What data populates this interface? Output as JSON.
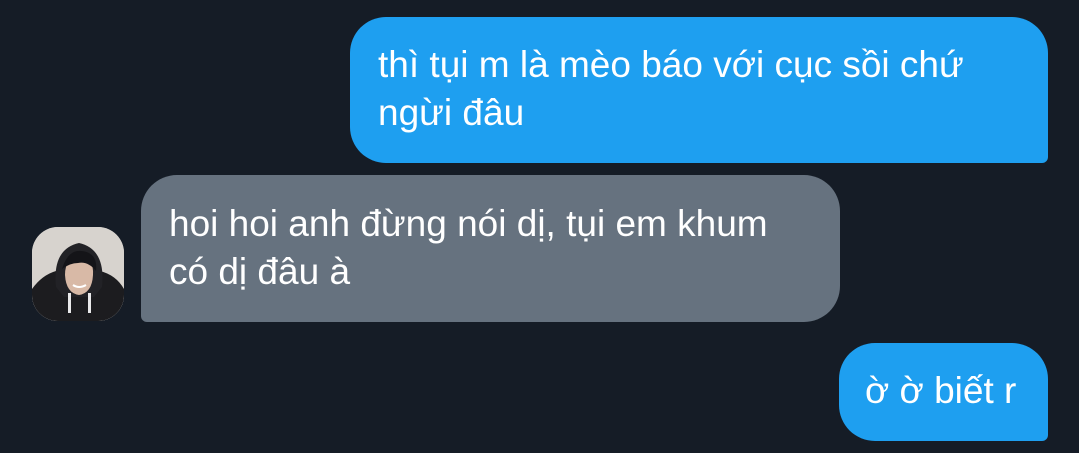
{
  "conversation": {
    "messages": [
      {
        "direction": "sent",
        "text": "thì tụi m là mèo báo với cục sồi chứ ngừi đâu"
      },
      {
        "direction": "received",
        "text": "hoi hoi anh đừng nói dị, tụi em khum có dị đâu à"
      },
      {
        "direction": "sent",
        "text": "ờ ờ biết r"
      }
    ]
  },
  "colors": {
    "background": "#151c26",
    "sent_bubble": "#1e9ff0",
    "received_bubble": "#66727f",
    "text": "#ffffff"
  },
  "icons": {
    "avatar": "contact-avatar-photo"
  }
}
